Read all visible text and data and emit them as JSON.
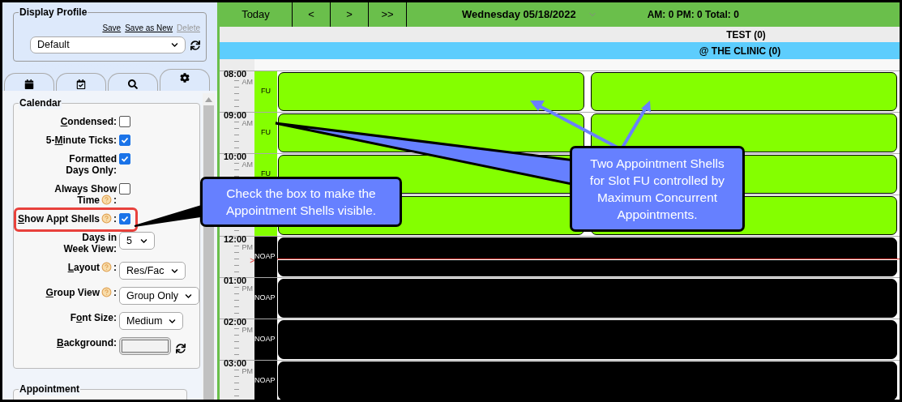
{
  "display_profile": {
    "legend": "Display Profile",
    "links": [
      {
        "label": "Save",
        "disabled": false
      },
      {
        "label": "Save as New",
        "disabled": false
      },
      {
        "label": "Delete",
        "disabled": true
      }
    ],
    "profile": "Default"
  },
  "tabs": [
    {
      "kind": "calendar",
      "selected": false
    },
    {
      "kind": "calendar-check",
      "selected": false
    },
    {
      "kind": "search",
      "selected": false
    },
    {
      "kind": "settings",
      "selected": true
    }
  ],
  "calendar_settings": {
    "legend": "Calendar",
    "rows": [
      {
        "lines": [
          [
            {
              "kind": "text",
              "text": "C",
              "underline": true
            },
            {
              "kind": "text",
              "text": "ondensed:",
              "underline": false
            }
          ]
        ],
        "control": {
          "kind": "checkbox",
          "checked": false
        },
        "highlighted": false
      },
      {
        "lines": [
          [
            {
              "kind": "text",
              "text": "5-",
              "underline": false
            },
            {
              "kind": "text",
              "text": "M",
              "underline": true
            },
            {
              "kind": "text",
              "text": "inute Ticks:",
              "underline": false
            }
          ]
        ],
        "control": {
          "kind": "checkbox",
          "checked": true
        },
        "highlighted": false
      },
      {
        "lines": [
          [
            {
              "kind": "text",
              "text": "Formatted",
              "underline": false
            }
          ],
          [
            {
              "kind": "text",
              "text": "Days Only:",
              "underline": false
            }
          ]
        ],
        "control": {
          "kind": "checkbox",
          "checked": true
        },
        "highlighted": false
      },
      {
        "lines": [
          [
            {
              "kind": "text",
              "text": "Always Show",
              "underline": false
            }
          ],
          [
            {
              "kind": "text",
              "text": "Time",
              "underline": false
            },
            {
              "kind": "help"
            },
            {
              "kind": "text",
              "text": ":",
              "underline": false
            }
          ]
        ],
        "control": {
          "kind": "checkbox",
          "checked": false
        },
        "highlighted": false
      },
      {
        "lines": [
          [
            {
              "kind": "text",
              "text": "S",
              "underline": true
            },
            {
              "kind": "text",
              "text": "how Appt Shells",
              "underline": false
            },
            {
              "kind": "help"
            },
            {
              "kind": "text",
              "text": ":",
              "underline": false
            }
          ]
        ],
        "control": {
          "kind": "checkbox",
          "checked": true
        },
        "highlighted": true
      },
      {
        "lines": [
          [
            {
              "kind": "text",
              "text": "Days in",
              "underline": false
            }
          ],
          [
            {
              "kind": "text",
              "text": "Week View:",
              "underline": false
            }
          ]
        ],
        "control": {
          "kind": "select",
          "value": "5"
        },
        "highlighted": false
      },
      {
        "lines": [
          [
            {
              "kind": "text",
              "text": "L",
              "underline": true
            },
            {
              "kind": "text",
              "text": "ayout",
              "underline": false
            },
            {
              "kind": "help"
            },
            {
              "kind": "text",
              "text": ":",
              "underline": false
            }
          ]
        ],
        "control": {
          "kind": "select",
          "value": "Res/Fac"
        },
        "highlighted": false
      },
      {
        "lines": [
          [
            {
              "kind": "text",
              "text": "G",
              "underline": true
            },
            {
              "kind": "text",
              "text": "roup View",
              "underline": false
            },
            {
              "kind": "help"
            },
            {
              "kind": "text",
              "text": ":",
              "underline": false
            }
          ]
        ],
        "control": {
          "kind": "select",
          "value": "Group Only"
        },
        "highlighted": false
      },
      {
        "lines": [
          [
            {
              "kind": "text",
              "text": "F",
              "underline": false
            },
            {
              "kind": "text",
              "text": "o",
              "underline": true
            },
            {
              "kind": "text",
              "text": "nt Size:",
              "underline": false
            }
          ]
        ],
        "control": {
          "kind": "select",
          "value": "Medium"
        },
        "highlighted": false
      },
      {
        "lines": [
          [
            {
              "kind": "text",
              "text": "B",
              "underline": true
            },
            {
              "kind": "text",
              "text": "ackground:",
              "underline": false
            }
          ]
        ],
        "control": {
          "kind": "color"
        },
        "highlighted": false
      }
    ]
  },
  "appointment_section": {
    "legend": "Appointment"
  },
  "toolbar": {
    "buttons": [
      "Today",
      "<",
      ">",
      ">>"
    ],
    "date": "Wednesday 05/18/2022",
    "totals": "AM: 0 PM: 0 Total: 0"
  },
  "resource": "TEST (0)",
  "facility": "@ THE CLINIC (0)",
  "hours": [
    {
      "time": "08:00",
      "period": "AM",
      "slot": "FU",
      "color": "#84ff00",
      "kind": "double"
    },
    {
      "time": "09:00",
      "period": "AM",
      "slot": "FU",
      "color": "#84ff00",
      "kind": "double"
    },
    {
      "time": "10:00",
      "period": "AM",
      "slot": "FU",
      "color": "#84ff00",
      "kind": "double"
    },
    {
      "color": "#84ff00",
      "kind": "double"
    },
    {
      "time": "12:00",
      "period": "PM",
      "slot": "NOAP",
      "color": "#000000",
      "kind": "single",
      "now_marker": ">"
    },
    {
      "time": "01:00",
      "period": "PM",
      "slot": "NOAP",
      "color": "#000000",
      "kind": "single"
    },
    {
      "time": "02:00",
      "period": "PM",
      "slot": "NOAP",
      "color": "#000000",
      "kind": "single"
    },
    {
      "time": "03:00",
      "period": "PM",
      "slot": "NOAP",
      "color": "#000000",
      "kind": "single"
    }
  ],
  "callouts": [
    {
      "text": "Check the box to make the Appointment Shells visible."
    },
    {
      "text": "Two Appointment Shells for Slot FU controlled by Maximum Concurrent Appointments."
    }
  ]
}
